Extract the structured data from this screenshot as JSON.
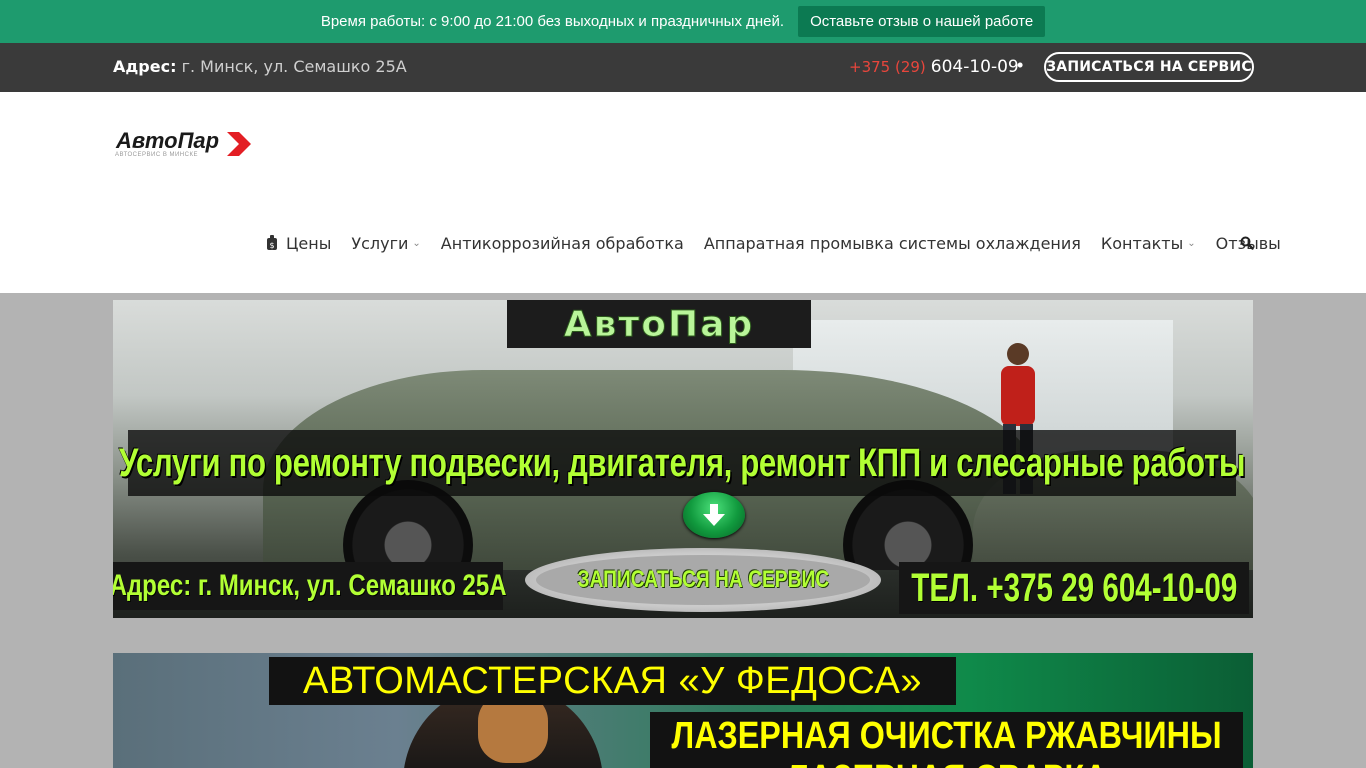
{
  "notice": {
    "text": "Время работы: с 9:00 до 21:00 без выходных и праздничных дней.",
    "review_button": "Оставьте отзыв о нашей работе"
  },
  "topbar": {
    "address_label": "Адрес:",
    "address_value": "г. Минск, ул. Семашко 25А",
    "phone_code": "+375 (29)",
    "phone_number": "604-10-09",
    "separator": "•",
    "book_button": "ЗАПИСАТЬСЯ НА СЕРВИС"
  },
  "logo": {
    "name": "АвтоПар",
    "tagline": "АВТОСЕРВИС В МИНСКЕ"
  },
  "nav": {
    "items": [
      {
        "label": "Цены",
        "icon": "price-tag-icon",
        "dropdown": false
      },
      {
        "label": "Услуги",
        "dropdown": true
      },
      {
        "label": "Антикоррозийная обработка",
        "dropdown": false
      },
      {
        "label": "Аппаратная промывка системы охлаждения",
        "dropdown": false
      },
      {
        "label": "Контакты",
        "dropdown": true
      },
      {
        "label": "Отзывы",
        "dropdown": false
      }
    ],
    "dropdown_glyph": "⌄"
  },
  "banner1": {
    "brand": "АвтоПар",
    "headline": "Услуги по ремонту подвески, двигателя, ремонт КПП и слесарные работы",
    "address": "Адрес: г. Минск, ул. Семашко 25А",
    "cta": "ЗАПИСАТЬСЯ НА СЕРВИС",
    "phone": "ТЕЛ. +375 29 604-10-09"
  },
  "banner2": {
    "title": "АВТОМАСТЕРСКАЯ «У ФЕДОСА»",
    "line1": "ЛАЗЕРНАЯ ОЧИСТКА РЖАВЧИНЫ",
    "line2": "ЛАЗЕРНАЯ СВАРКА"
  },
  "colors": {
    "notice_bg": "#1e9b6e",
    "notice_button": "#0c7a52",
    "topbar_bg": "#3a3a3a",
    "phone_code": "#e8463c",
    "banner_text_green": "#b2ff34",
    "banner2_text_yellow": "#ffff00",
    "logo_arrow": "#e31e24"
  }
}
